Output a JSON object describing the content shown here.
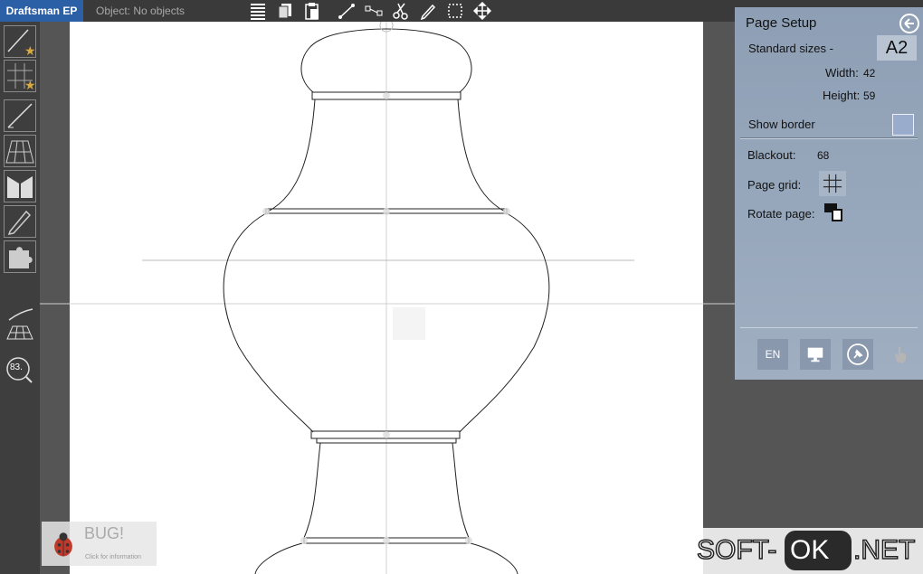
{
  "app": {
    "title": "Draftsman EP",
    "object_status": "Object: No objects"
  },
  "toolbar": {
    "icons": [
      "align-icon",
      "copy-icon",
      "paste-icon",
      "line-icon",
      "segment-icon",
      "scissors-icon",
      "pencil-icon",
      "select-rect-icon",
      "move-icon"
    ]
  },
  "left_tools": {
    "items": [
      "new-line-tool-icon",
      "new-grid-tool-icon",
      "line-tool-icon",
      "perspective-grid-icon",
      "fold-tool-icon",
      "pencil-tool-icon",
      "puzzle-tool-icon",
      "curve-tool-icon",
      "grid-tool-icon",
      "zoom-tool-icon"
    ],
    "zoom_value": "83."
  },
  "page_setup": {
    "title": "Page Setup",
    "standard_sizes_label": "Standard sizes -",
    "standard_size_value": "A2",
    "width_label": "Width:",
    "width_value": "42",
    "height_label": "Height:",
    "height_value": "59",
    "show_border_label": "Show border",
    "blackout_label": "Blackout:",
    "blackout_value": "68",
    "page_grid_label": "Page grid:",
    "rotate_page_label": "Rotate page:",
    "language_button": "EN"
  },
  "bug_widget": {
    "title": "BUG!",
    "subtitle": "Click for information"
  },
  "watermark": {
    "soft": "SOFT-",
    "ok": "OK",
    "net": ".NET"
  },
  "colors": {
    "title_bar": "#2b5fa6",
    "panel": "#98a8bc",
    "paper": "#ffffff",
    "background": "#555555"
  }
}
